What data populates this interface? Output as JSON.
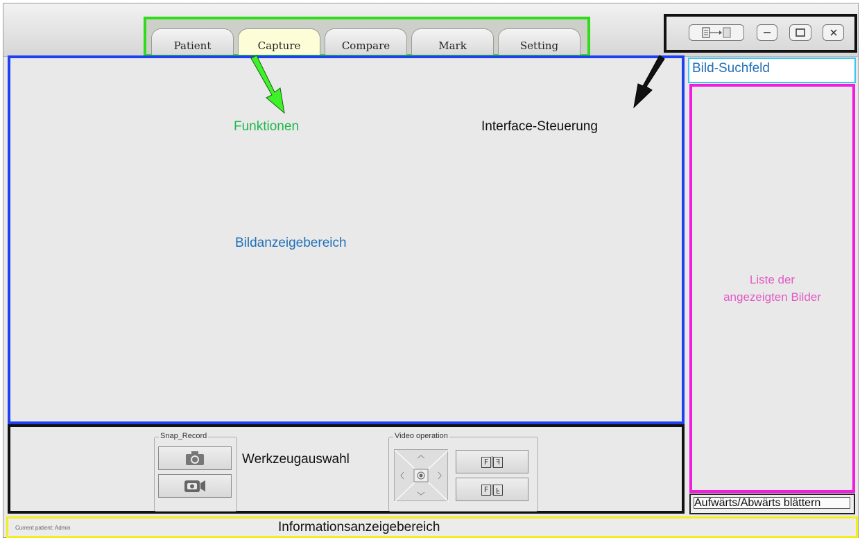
{
  "tabs": [
    {
      "label": "Patient",
      "active": false
    },
    {
      "label": "Capture",
      "active": true
    },
    {
      "label": "Compare",
      "active": false
    },
    {
      "label": "Mark",
      "active": false
    },
    {
      "label": "Setting",
      "active": false
    }
  ],
  "window_controls": [
    "layout-toggle-icon",
    "minimize-icon",
    "maximize-icon",
    "close-icon"
  ],
  "annotations": {
    "functions": "Funktionen",
    "interface_control": "Interface-Steuerung",
    "display_area": "Bildanzeigebereich",
    "tool_selection": "Werkzeugauswahl",
    "info_area": "Informationsanzeigebereich",
    "image_list_line1": "Liste der",
    "image_list_line2": "angezeigten Bilder"
  },
  "search_field": {
    "label": "Bild-Suchfeld"
  },
  "scroll": {
    "label": "Aufwärts/Abwärts blättern"
  },
  "tools": {
    "snap_record_title": "Snap_Record",
    "video_operation_title": "Video operation"
  },
  "status": {
    "current_patient": "Current patient: Admin"
  },
  "colors": {
    "functions_box": "#2edc19",
    "controls_box": "#111111",
    "display_box": "#1f3ff2",
    "search_box": "#3cc6f2",
    "list_box": "#f31cde",
    "info_box": "#f5ee1f"
  }
}
